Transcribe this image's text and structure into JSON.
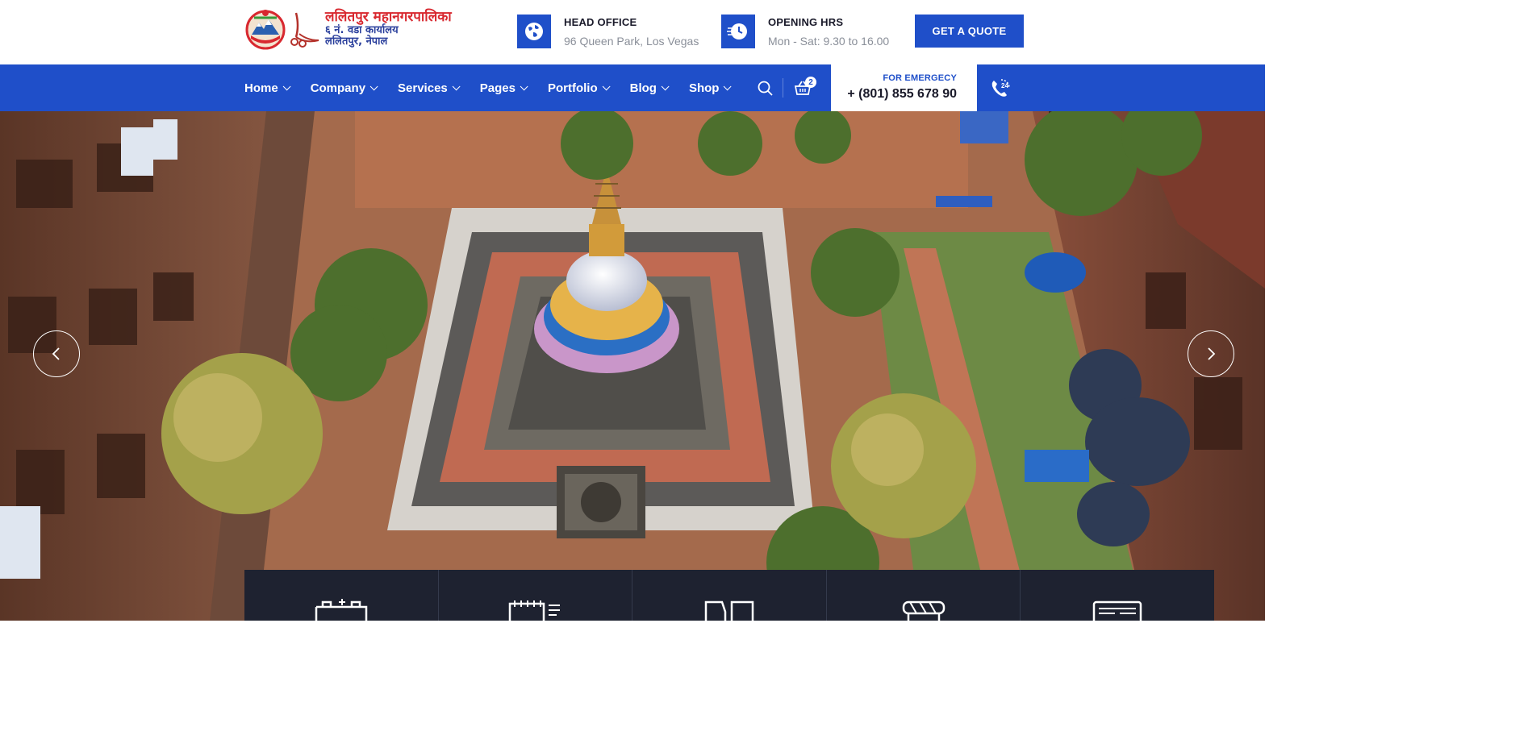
{
  "brand": {
    "line1": "ललितपुर महानगरपालिका",
    "line2": "६ नं. वडा कार्यालय",
    "line3": "ललितपुर, नेपाल",
    "colors": {
      "primary": "#1f4fc9",
      "dark": "#1e2230",
      "logo_red": "#d8282f",
      "logo_blue": "#2a3f9c"
    }
  },
  "header": {
    "head_office": {
      "icon": "globe-icon",
      "label": "HEAD OFFICE",
      "value": "96 Queen Park, Los Vegas"
    },
    "opening_hours": {
      "icon": "clock-icon",
      "label": "OPENING HRS",
      "value": "Mon - Sat: 9.30 to 16.00"
    },
    "quote_button": "GET A QUOTE"
  },
  "nav": {
    "items": [
      {
        "label": "Home"
      },
      {
        "label": "Company"
      },
      {
        "label": "Services"
      },
      {
        "label": "Pages"
      },
      {
        "label": "Portfolio"
      },
      {
        "label": "Blog"
      },
      {
        "label": "Shop"
      }
    ],
    "cart_count": "2",
    "emergency": {
      "label": "FOR EMERGECY",
      "phone": "+ (801) 855 678 90",
      "icon": "24h-phone-icon"
    }
  },
  "hero": {
    "prev_icon": "chevron-left-icon",
    "next_icon": "chevron-right-icon",
    "feature_icons": [
      "battery-icon",
      "calendar-icon",
      "vehicles-icon",
      "construction-barrier-icon",
      "newspaper-icon"
    ]
  }
}
